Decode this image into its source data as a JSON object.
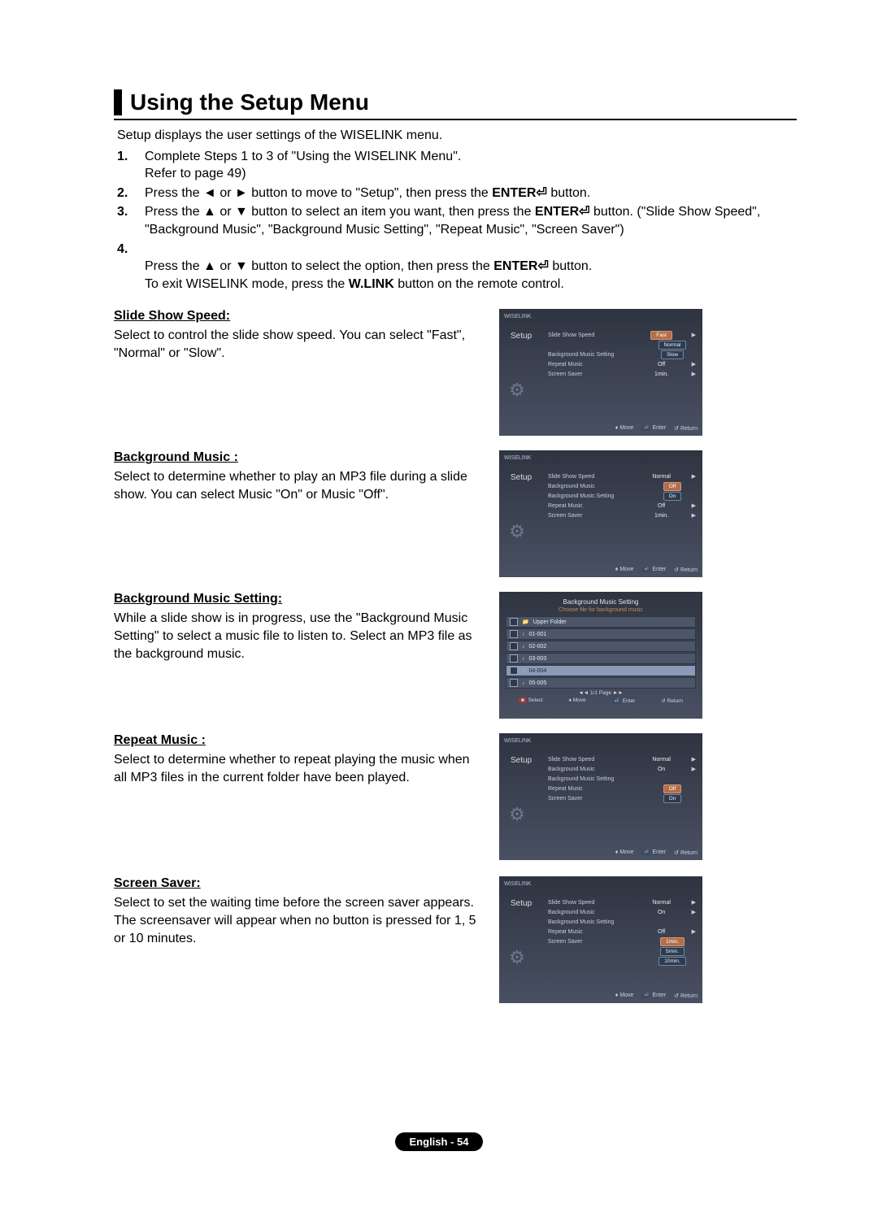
{
  "title": "Using the Setup Menu",
  "intro": "Setup displays the user settings of the WISELINK menu.",
  "steps": [
    {
      "num": "1.",
      "text": "Complete Steps 1 to 3 of \"Using the WISELINK Menu\".\nRefer to page 49)"
    },
    {
      "num": "2.",
      "text_prefix": "Press the ◄ or ► button to move to \"Setup\", then press the ",
      "bold1": "ENTER⏎",
      "text_suffix": " button."
    },
    {
      "num": "3.",
      "text_prefix": "Press the ▲ or ▼ button to select an item you want, then press the ",
      "bold1": "ENTER⏎",
      "text_mid": " button. (\"Slide Show Speed\",  \"Background Music\", \"Background Music Setting\", \"Repeat Music\", \"Screen Saver\")",
      "text_suffix": ""
    },
    {
      "num": "4.",
      "text_prefix": "Press the ▲ or ▼ button to select the option, then press the ",
      "bold1": "ENTER⏎",
      "text_mid": " button.\nTo exit WISELINK mode, press the ",
      "bold2": "W.LINK",
      "text_suffix": " button on the remote control."
    }
  ],
  "sections": {
    "slide": {
      "heading": "Slide Show Speed:",
      "text": "Select to control the slide show speed. You can select \"Fast\", \"Normal\" or \"Slow\"."
    },
    "bgm": {
      "heading": "Background Music :",
      "text": "Select to determine whether to play an MP3 file during a slide show. You can select Music \"On\" or Music \"Off\"."
    },
    "bgms": {
      "heading": "Background Music Setting:",
      "text": "While a slide show is in progress, use the \"Background Music Setting\" to select a music file to listen to. Select an MP3 file as the background music."
    },
    "repeat": {
      "heading": "Repeat Music :",
      "text": "Select to determine whether to repeat playing the music when all MP3 files in the current folder have been played."
    },
    "ss": {
      "heading": "Screen Saver:",
      "text": "Select to set the waiting time before the screen saver appears. The screensaver will appear when no button is pressed for 1, 5 or 10 minutes."
    }
  },
  "osd": {
    "brand": "WISELINK",
    "side": "Setup",
    "gear_icon": "⚙︎",
    "help": {
      "move": "Move",
      "enter": "Enter",
      "return": "Return",
      "select": "Select"
    },
    "menu_labels": {
      "sss": "Slide Show Speed",
      "bgm": "Background Music",
      "bgms": "Background Music Setting",
      "rep": "Repeat Music",
      "ss": "Screen Saver"
    },
    "values": {
      "normal": "Normal",
      "fast": "Fast",
      "slow": "Slow",
      "on": "On",
      "off": "Off",
      "one": "1min.",
      "five": "5min.",
      "ten": "10min."
    },
    "fl": {
      "title": "Background Music Setting",
      "sub": "Choose file for background music",
      "upper": "Upper Folder",
      "files": [
        "01-001",
        "02-002",
        "03-003",
        "04-004",
        "05-005"
      ],
      "pager": "◄◄ 1/1 Page ►►"
    }
  },
  "footer": "English - 54"
}
